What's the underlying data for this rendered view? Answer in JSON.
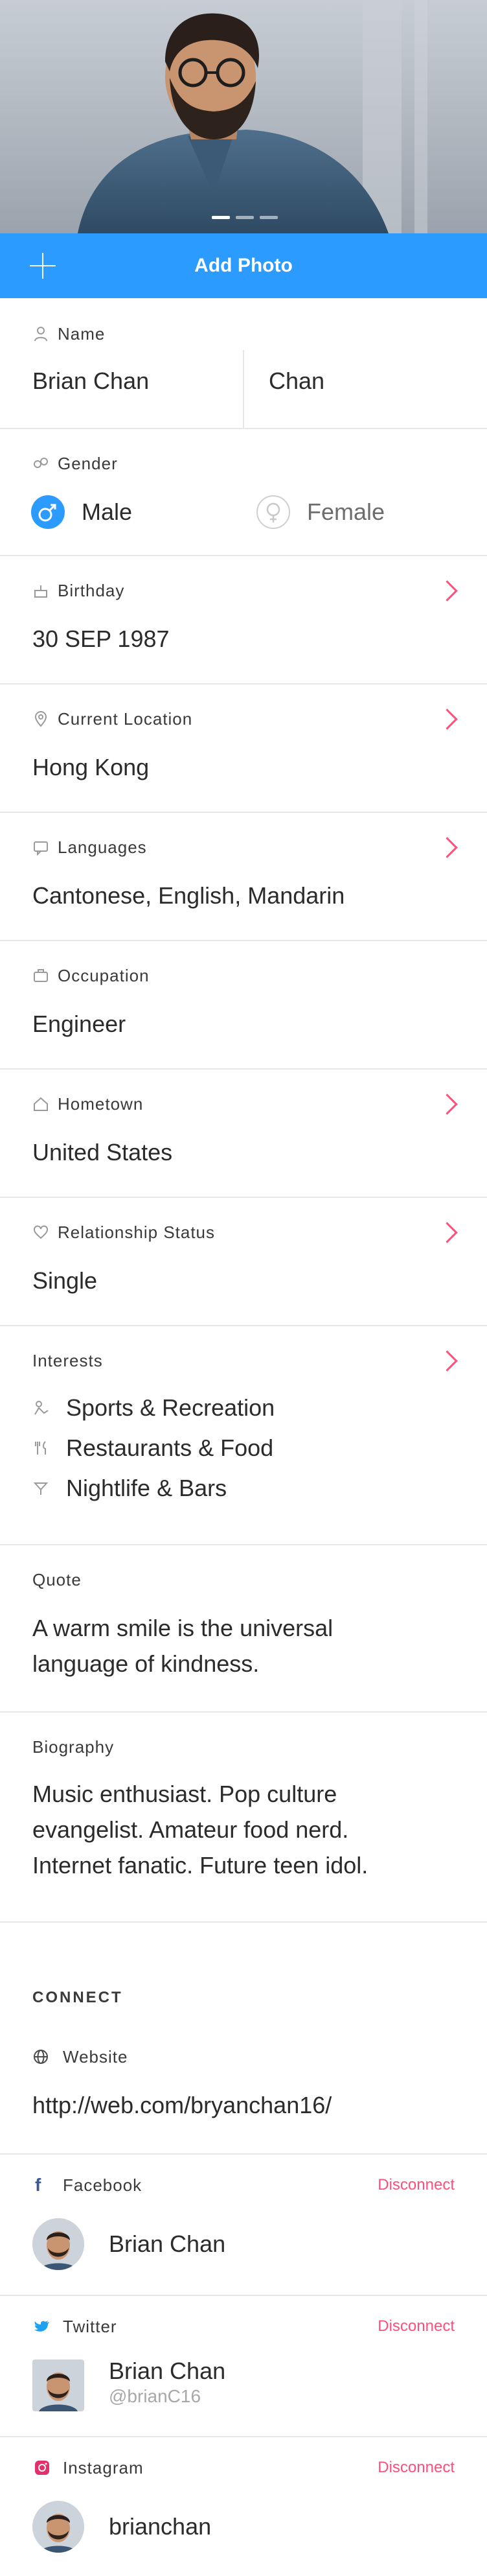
{
  "photo": {
    "dots_total": 3,
    "dot_active": 1
  },
  "add_photo": {
    "label": "Add Photo"
  },
  "name": {
    "label": "Name",
    "first": "Brian Chan",
    "last": "Chan"
  },
  "gender": {
    "label": "Gender",
    "male": "Male",
    "female": "Female",
    "selected": "Male",
    "accent": "#2c9bff"
  },
  "birthday": {
    "label": "Birthday",
    "value": "30 SEP 1987"
  },
  "location": {
    "label": "Current Location",
    "value": "Hong Kong"
  },
  "languages": {
    "label": "Languages",
    "value": "Cantonese, English, Mandarin"
  },
  "occupation": {
    "label": "Occupation",
    "value": "Engineer"
  },
  "hometown": {
    "label": "Hometown",
    "value": "United States"
  },
  "relationship": {
    "label": "Relationship Status",
    "value": "Single"
  },
  "interests": {
    "label": "Interests",
    "items": [
      {
        "icon": "sports-icon",
        "label": "Sports & Recreation"
      },
      {
        "icon": "fork-knife-icon",
        "label": "Restaurants & Food"
      },
      {
        "icon": "cocktail-icon",
        "label": "Nightlife & Bars"
      }
    ]
  },
  "quote": {
    "label": "Quote",
    "line1": "A warm smile is the universal",
    "line2": "language of kindness."
  },
  "biography": {
    "label": "Biography",
    "line1": "Music enthusiast. Pop culture",
    "line2": "evangelist. Amateur food nerd.",
    "line3": "Internet fanatic. Future teen idol."
  },
  "connect": {
    "title": "CONNECT",
    "website": {
      "label": "Website",
      "value": "http://web.com/bryanchan16/"
    },
    "facebook": {
      "label": "Facebook",
      "action": "Disconnect",
      "name": "Brian Chan",
      "color": "#3b5998"
    },
    "twitter": {
      "label": "Twitter",
      "action": "Disconnect",
      "name": "Brian Chan",
      "handle": "@brianC16",
      "color": "#1da1f2"
    },
    "instagram": {
      "label": "Instagram",
      "action": "Disconnect",
      "name": "brianchan",
      "color": "#e1306c"
    }
  },
  "colors": {
    "accent_pink": "#ff4f7b",
    "primary_blue": "#2c9bff",
    "divider": "#e7e7e7"
  }
}
